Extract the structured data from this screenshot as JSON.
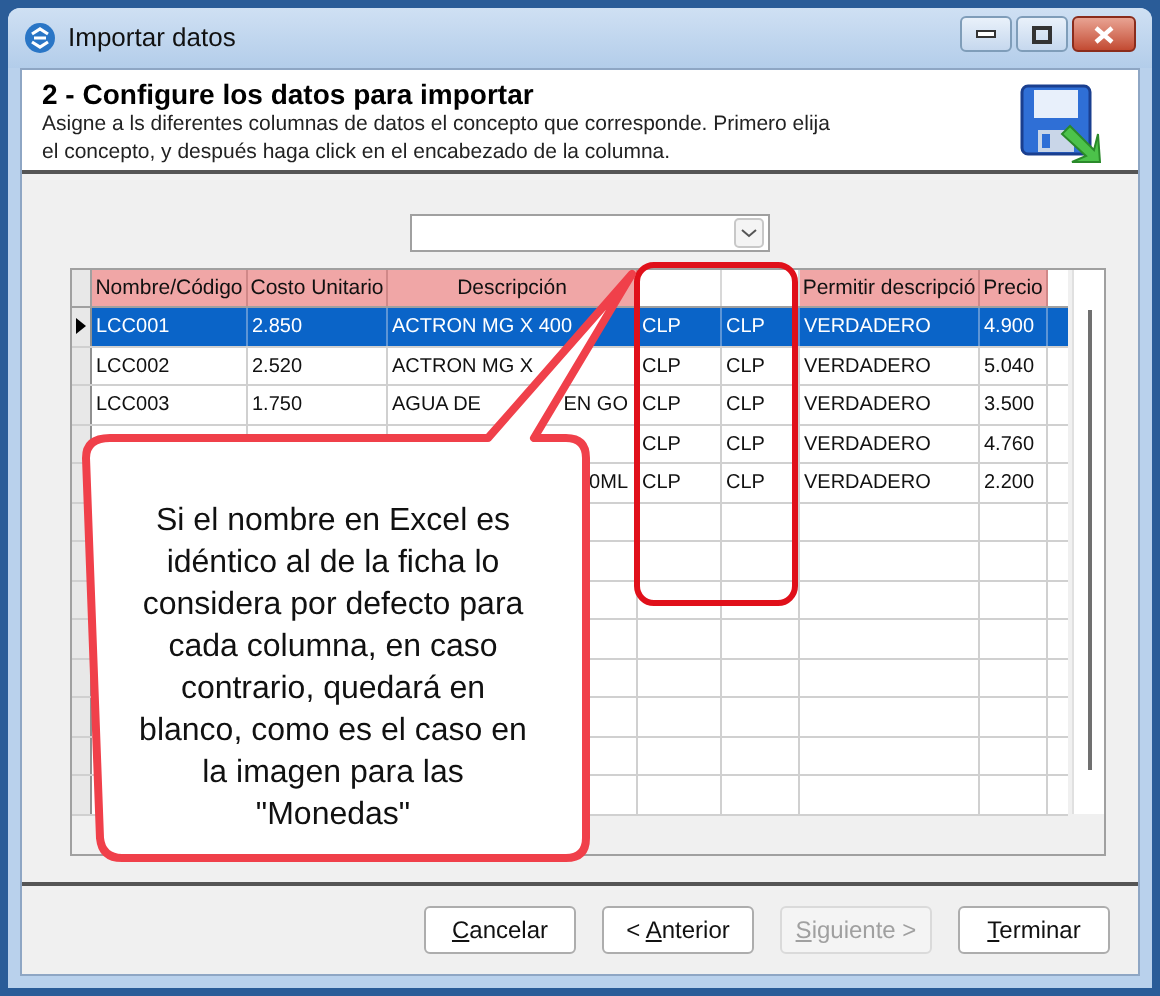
{
  "window": {
    "title": "Importar datos"
  },
  "header": {
    "title": "2 - Configure los datos para importar",
    "description": "Asigne a ls diferentes columnas de datos el concepto que corresponde. Primero elija el concepto, y después haga click en el encabezado de la columna."
  },
  "table": {
    "columns": [
      {
        "label": "Nombre/Código",
        "highlighted": true
      },
      {
        "label": "Costo Unitario",
        "highlighted": true
      },
      {
        "label": "Descripción",
        "highlighted": true
      },
      {
        "highlighted": false
      },
      {
        "highlighted": false
      },
      {
        "label": "Permitir descripció",
        "highlighted": true
      },
      {
        "label": "Precio",
        "highlighted": true
      }
    ],
    "rows": [
      {
        "selected": true,
        "current": true,
        "cells": [
          "LCC001",
          "2.850",
          "ACTRON MG X 400",
          "CLP",
          "CLP",
          "VERDADERO",
          "4.900"
        ]
      },
      {
        "selected": false,
        "current": false,
        "cells": [
          "LCC002",
          "2.520",
          "ACTRON MG X",
          "CLP",
          "CLP",
          "VERDADERO",
          "5.040"
        ]
      },
      {
        "selected": false,
        "current": false,
        "cells": [
          "LCC003",
          "1.750",
          [
            "AGUA DE",
            "EN GO"
          ],
          "CLP",
          "CLP",
          "VERDADERO",
          "3.500"
        ]
      },
      {
        "selected": false,
        "current": false,
        "cells": [
          null,
          null,
          null,
          "CLP",
          "CLP",
          "VERDADERO",
          "4.760"
        ]
      },
      {
        "selected": false,
        "current": false,
        "cells": [
          null,
          null,
          [
            null,
            "0ML"
          ],
          "CLP",
          "CLP",
          "VERDADERO",
          "2.200"
        ]
      }
    ]
  },
  "callout": {
    "text": "Si el nombre en Excel es idéntico al de la ficha lo considera por defecto para cada columna, en caso contrario, quedará en blanco, como es el caso en la imagen para las \"Monedas\""
  },
  "buttons": [
    {
      "key": "C",
      "after": "ancelar",
      "disabled": false
    },
    {
      "before": "< ",
      "key": "A",
      "after": "nterior",
      "disabled": false
    },
    {
      "key": "S",
      "after": "iguiente >",
      "disabled": true
    },
    {
      "key": "T",
      "after": "erminar",
      "disabled": false
    }
  ]
}
